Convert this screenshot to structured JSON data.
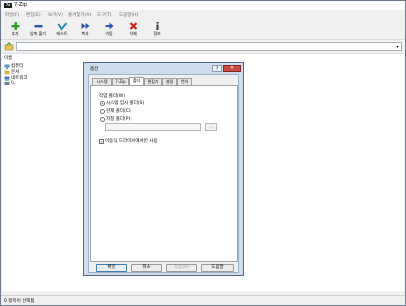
{
  "window": {
    "title": "7-Zip",
    "app_icon": "7z"
  },
  "menu": [
    "파일(F)",
    "편집(E)",
    "보기(V)",
    "즐겨찾기(A)",
    "도구(T)",
    "도움말(H)"
  ],
  "toolbar": {
    "add": "추가",
    "extract": "압축 풀기",
    "test": "테스트",
    "copy": "복사",
    "move": "이동",
    "delete": "삭제",
    "info": "정보"
  },
  "file_list": {
    "column_name": "이름",
    "items": [
      "컴퓨터",
      "문서",
      "네트워크",
      "\\\\."
    ]
  },
  "status": {
    "text": "0 항목이 선택됨"
  },
  "dialog": {
    "title": "옵션",
    "help": "?",
    "close": "✕",
    "tabs": [
      "시스템",
      "7-Zip",
      "폴더",
      "편집기",
      "설정",
      "언어"
    ],
    "active_tab_index": 2,
    "group_label": "작업 폴더(W)",
    "radio_options": [
      "시스템 임시 폴더(S)",
      "현재 폴더(C)",
      "지정 폴더(P):"
    ],
    "selected_radio_index": 0,
    "path_value": "",
    "browse_label": "...",
    "removable_label": "이동식 드라이브에서만 사용",
    "removable_checked": true,
    "buttons": {
      "ok": "확인",
      "cancel": "취소",
      "apply": "적용(A)",
      "help": "도움말"
    }
  },
  "colors": {
    "add_icon": "#2e9a2e",
    "extract_icon": "#2b55a8",
    "test_icon": "#2b8fa0",
    "copy_icon": "#2b55a8",
    "move_icon": "#2b55a8",
    "delete_icon": "#cc2020",
    "info_icon": "#3a3a3a"
  }
}
